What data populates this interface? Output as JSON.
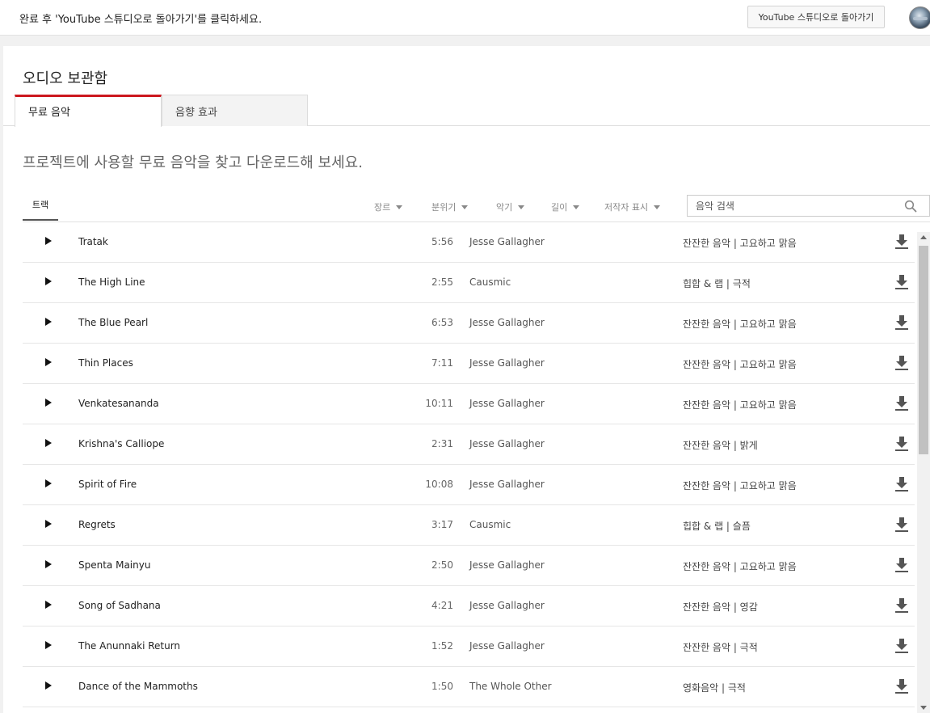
{
  "topbar": {
    "message": "완료 후 'YouTube 스튜디오로 돌아가기'를 클릭하세요.",
    "back_button": "YouTube 스튜디오로 돌아가기",
    "avatar_icon": "user-avatar"
  },
  "page": {
    "title": "오디오 보관함",
    "tabs": [
      {
        "label": "무료 음악",
        "active": true
      },
      {
        "label": "음향 효과",
        "active": false
      }
    ],
    "intro": "프로젝트에 사용할 무료 음악을 찾고 다운로드해 보세요."
  },
  "filters": {
    "tracks_tab": "트랙",
    "genre": "장르",
    "mood": "분위기",
    "instrument": "악기",
    "duration": "길이",
    "attribution": "저작자 표시",
    "search_placeholder": "음악 검색"
  },
  "tracks": [
    {
      "title": "Tratak",
      "duration": "5:56",
      "artist": "Jesse Gallagher",
      "genre_mood": "잔잔한 음악 | 고요하고 맑음"
    },
    {
      "title": "The High Line",
      "duration": "2:55",
      "artist": "Causmic",
      "genre_mood": "힙합 & 랩 | 극적"
    },
    {
      "title": "The Blue Pearl",
      "duration": "6:53",
      "artist": "Jesse Gallagher",
      "genre_mood": "잔잔한 음악 | 고요하고 맑음"
    },
    {
      "title": "Thin Places",
      "duration": "7:11",
      "artist": "Jesse Gallagher",
      "genre_mood": "잔잔한 음악 | 고요하고 맑음"
    },
    {
      "title": "Venkatesananda",
      "duration": "10:11",
      "artist": "Jesse Gallagher",
      "genre_mood": "잔잔한 음악 | 고요하고 맑음"
    },
    {
      "title": "Krishna's Calliope",
      "duration": "2:31",
      "artist": "Jesse Gallagher",
      "genre_mood": "잔잔한 음악 | 밝게"
    },
    {
      "title": "Spirit of Fire",
      "duration": "10:08",
      "artist": "Jesse Gallagher",
      "genre_mood": "잔잔한 음악 | 고요하고 맑음"
    },
    {
      "title": "Regrets",
      "duration": "3:17",
      "artist": "Causmic",
      "genre_mood": "힙합 & 랩 | 슬픔"
    },
    {
      "title": "Spenta Mainyu",
      "duration": "2:50",
      "artist": "Jesse Gallagher",
      "genre_mood": "잔잔한 음악 | 고요하고 맑음"
    },
    {
      "title": "Song of Sadhana",
      "duration": "4:21",
      "artist": "Jesse Gallagher",
      "genre_mood": "잔잔한 음악 | 영감"
    },
    {
      "title": "The Anunnaki Return",
      "duration": "1:52",
      "artist": "Jesse Gallagher",
      "genre_mood": "잔잔한 음악 | 극적"
    },
    {
      "title": "Dance of the Mammoths",
      "duration": "1:50",
      "artist": "The Whole Other",
      "genre_mood": "영화음악 | 극적"
    }
  ],
  "colors": {
    "accent": "#cc181e",
    "background": "#f1f1f1"
  },
  "icons": {
    "play": "play-icon",
    "download": "download-icon",
    "search": "search-icon",
    "dropdown": "caret-down-icon"
  }
}
